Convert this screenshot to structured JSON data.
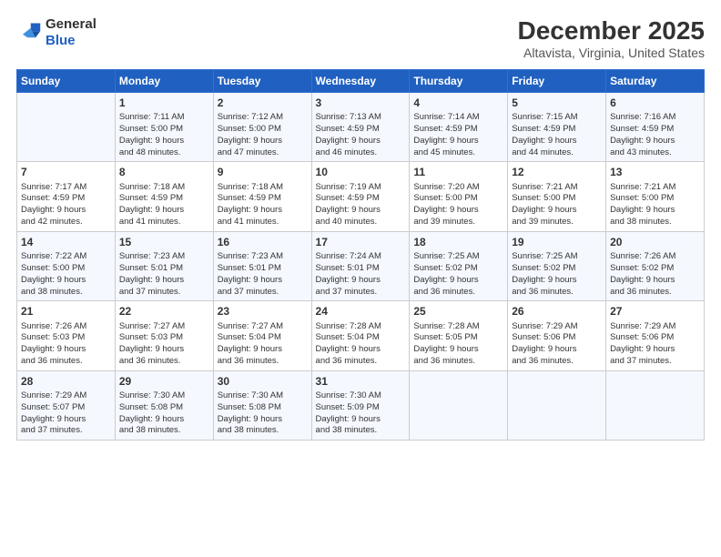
{
  "header": {
    "logo_general": "General",
    "logo_blue": "Blue",
    "month_title": "December 2025",
    "location": "Altavista, Virginia, United States"
  },
  "weekdays": [
    "Sunday",
    "Monday",
    "Tuesday",
    "Wednesday",
    "Thursday",
    "Friday",
    "Saturday"
  ],
  "weeks": [
    [
      {
        "day": "",
        "info": ""
      },
      {
        "day": "1",
        "info": "Sunrise: 7:11 AM\nSunset: 5:00 PM\nDaylight: 9 hours\nand 48 minutes."
      },
      {
        "day": "2",
        "info": "Sunrise: 7:12 AM\nSunset: 5:00 PM\nDaylight: 9 hours\nand 47 minutes."
      },
      {
        "day": "3",
        "info": "Sunrise: 7:13 AM\nSunset: 4:59 PM\nDaylight: 9 hours\nand 46 minutes."
      },
      {
        "day": "4",
        "info": "Sunrise: 7:14 AM\nSunset: 4:59 PM\nDaylight: 9 hours\nand 45 minutes."
      },
      {
        "day": "5",
        "info": "Sunrise: 7:15 AM\nSunset: 4:59 PM\nDaylight: 9 hours\nand 44 minutes."
      },
      {
        "day": "6",
        "info": "Sunrise: 7:16 AM\nSunset: 4:59 PM\nDaylight: 9 hours\nand 43 minutes."
      }
    ],
    [
      {
        "day": "7",
        "info": "Sunrise: 7:17 AM\nSunset: 4:59 PM\nDaylight: 9 hours\nand 42 minutes."
      },
      {
        "day": "8",
        "info": "Sunrise: 7:18 AM\nSunset: 4:59 PM\nDaylight: 9 hours\nand 41 minutes."
      },
      {
        "day": "9",
        "info": "Sunrise: 7:18 AM\nSunset: 4:59 PM\nDaylight: 9 hours\nand 41 minutes."
      },
      {
        "day": "10",
        "info": "Sunrise: 7:19 AM\nSunset: 4:59 PM\nDaylight: 9 hours\nand 40 minutes."
      },
      {
        "day": "11",
        "info": "Sunrise: 7:20 AM\nSunset: 5:00 PM\nDaylight: 9 hours\nand 39 minutes."
      },
      {
        "day": "12",
        "info": "Sunrise: 7:21 AM\nSunset: 5:00 PM\nDaylight: 9 hours\nand 39 minutes."
      },
      {
        "day": "13",
        "info": "Sunrise: 7:21 AM\nSunset: 5:00 PM\nDaylight: 9 hours\nand 38 minutes."
      }
    ],
    [
      {
        "day": "14",
        "info": "Sunrise: 7:22 AM\nSunset: 5:00 PM\nDaylight: 9 hours\nand 38 minutes."
      },
      {
        "day": "15",
        "info": "Sunrise: 7:23 AM\nSunset: 5:01 PM\nDaylight: 9 hours\nand 37 minutes."
      },
      {
        "day": "16",
        "info": "Sunrise: 7:23 AM\nSunset: 5:01 PM\nDaylight: 9 hours\nand 37 minutes."
      },
      {
        "day": "17",
        "info": "Sunrise: 7:24 AM\nSunset: 5:01 PM\nDaylight: 9 hours\nand 37 minutes."
      },
      {
        "day": "18",
        "info": "Sunrise: 7:25 AM\nSunset: 5:02 PM\nDaylight: 9 hours\nand 36 minutes."
      },
      {
        "day": "19",
        "info": "Sunrise: 7:25 AM\nSunset: 5:02 PM\nDaylight: 9 hours\nand 36 minutes."
      },
      {
        "day": "20",
        "info": "Sunrise: 7:26 AM\nSunset: 5:02 PM\nDaylight: 9 hours\nand 36 minutes."
      }
    ],
    [
      {
        "day": "21",
        "info": "Sunrise: 7:26 AM\nSunset: 5:03 PM\nDaylight: 9 hours\nand 36 minutes."
      },
      {
        "day": "22",
        "info": "Sunrise: 7:27 AM\nSunset: 5:03 PM\nDaylight: 9 hours\nand 36 minutes."
      },
      {
        "day": "23",
        "info": "Sunrise: 7:27 AM\nSunset: 5:04 PM\nDaylight: 9 hours\nand 36 minutes."
      },
      {
        "day": "24",
        "info": "Sunrise: 7:28 AM\nSunset: 5:04 PM\nDaylight: 9 hours\nand 36 minutes."
      },
      {
        "day": "25",
        "info": "Sunrise: 7:28 AM\nSunset: 5:05 PM\nDaylight: 9 hours\nand 36 minutes."
      },
      {
        "day": "26",
        "info": "Sunrise: 7:29 AM\nSunset: 5:06 PM\nDaylight: 9 hours\nand 36 minutes."
      },
      {
        "day": "27",
        "info": "Sunrise: 7:29 AM\nSunset: 5:06 PM\nDaylight: 9 hours\nand 37 minutes."
      }
    ],
    [
      {
        "day": "28",
        "info": "Sunrise: 7:29 AM\nSunset: 5:07 PM\nDaylight: 9 hours\nand 37 minutes."
      },
      {
        "day": "29",
        "info": "Sunrise: 7:30 AM\nSunset: 5:08 PM\nDaylight: 9 hours\nand 38 minutes."
      },
      {
        "day": "30",
        "info": "Sunrise: 7:30 AM\nSunset: 5:08 PM\nDaylight: 9 hours\nand 38 minutes."
      },
      {
        "day": "31",
        "info": "Sunrise: 7:30 AM\nSunset: 5:09 PM\nDaylight: 9 hours\nand 38 minutes."
      },
      {
        "day": "",
        "info": ""
      },
      {
        "day": "",
        "info": ""
      },
      {
        "day": "",
        "info": ""
      }
    ]
  ]
}
